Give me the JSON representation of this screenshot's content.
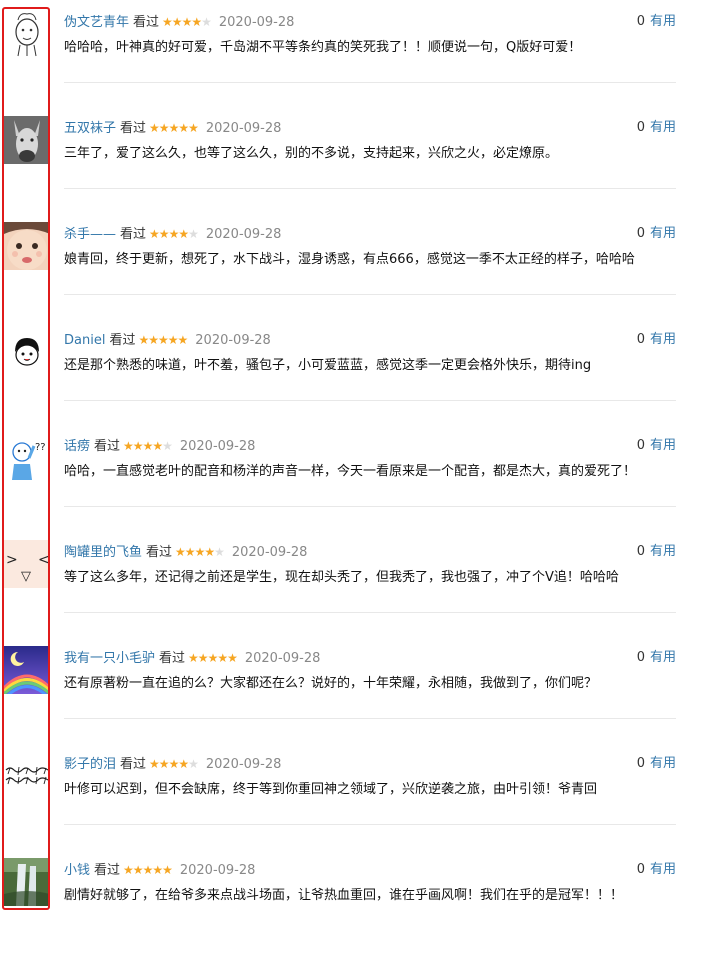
{
  "comments": [
    {
      "name": "伪文艺青年",
      "status": "看过",
      "rating": 4,
      "date": "2020-09-28",
      "useful_count": "0",
      "useful_label": "有用",
      "text": "哈哈哈，叶神真的好可爱，千岛湖不平等条约真的笑死我了！！顺便说一句，Q版好可爱！",
      "avatar": "doodle-face-avatar"
    },
    {
      "name": "五双袜子",
      "status": "看过",
      "rating": 5,
      "date": "2020-09-28",
      "useful_count": "0",
      "useful_label": "有用",
      "text": "三年了，爱了这么久，也等了这么久，别的不多说，支持起来，兴欣之火，必定燎原。",
      "avatar": "donkey-photo-avatar"
    },
    {
      "name": "杀手——",
      "status": "看过",
      "rating": 4,
      "date": "2020-09-28",
      "useful_count": "0",
      "useful_label": "有用",
      "text": "娘青回，终于更新，想死了，水下战斗，湿身诱惑，有点666，感觉这一季不太正经的样子，哈哈哈",
      "avatar": "baby-photo-avatar"
    },
    {
      "name": "Daniel",
      "status": "看过",
      "rating": 5,
      "date": "2020-09-28",
      "useful_count": "0",
      "useful_label": "有用",
      "text": "还是那个熟悉的味道，叶不羞，骚包子，小可爱蓝蓝，感觉这季一定更会格外快乐，期待ing",
      "avatar": "cartoon-boy-avatar"
    },
    {
      "name": "话痨",
      "status": "看过",
      "rating": 4,
      "date": "2020-09-28",
      "useful_count": "0",
      "useful_label": "有用",
      "text": "哈哈，一直感觉老叶的配音和杨洋的声音一样，今天一看原来是一个配音，都是杰大，真的爱死了！",
      "avatar": "confused-cartoon-avatar"
    },
    {
      "name": "陶罐里的飞鱼",
      "status": "看过",
      "rating": 4,
      "date": "2020-09-28",
      "useful_count": "0",
      "useful_label": "有用",
      "text": "等了这么多年，还记得之前还是学生，现在却头秃了，但我秃了，我也强了，冲了个V追！哈哈哈",
      "avatar": "emoticon-face-avatar"
    },
    {
      "name": "我有一只小毛驴",
      "status": "看过",
      "rating": 5,
      "date": "2020-09-28",
      "useful_count": "0",
      "useful_label": "有用",
      "text": "还有原著粉一直在追的么？大家都还在么？说好的，十年荣耀，永相随，我做到了，你们呢？",
      "avatar": "rainbow-moon-avatar"
    },
    {
      "name": "影子的泪",
      "status": "看过",
      "rating": 4,
      "date": "2020-09-28",
      "useful_count": "0",
      "useful_label": "有用",
      "text": "叶修可以迟到，但不会缺席，终于等到你重回神之领域了，兴欣逆袭之旅，由叶引领！爷青回",
      "avatar": "calligraphy-avatar",
      "avatar_text": "未曾清贫难成人 不经打击老天真"
    },
    {
      "name": "小钱",
      "status": "看过",
      "rating": 5,
      "date": "2020-09-28",
      "useful_count": "0",
      "useful_label": "有用",
      "text": "剧情好就够了，在给爷多来点战斗场面，让爷热血重回，谁在乎画风啊！我们在乎的是冠军！！！",
      "avatar": "waterfall-photo-avatar"
    }
  ],
  "colors": {
    "star": "#f6a623",
    "star_empty": "#dddddd",
    "link": "#3377aa",
    "highlight_border": "#e01b1b"
  }
}
